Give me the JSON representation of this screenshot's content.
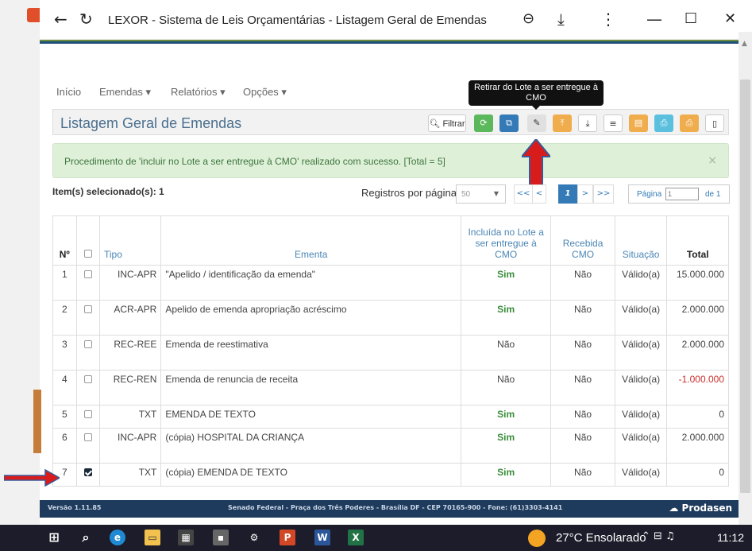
{
  "window": {
    "title": "LEXOR - Sistema de Leis Orçamentárias - Listagem Geral de Emendas"
  },
  "nav": {
    "items": [
      "Início",
      "Emendas ▾",
      "Relatórios ▾",
      "Opções ▾"
    ]
  },
  "panel": {
    "title": "Listagem Geral de Emendas",
    "filter_label": "Filtrar"
  },
  "toolbar_buttons": [
    {
      "icon": "refresh-icon",
      "color": "#5cb85c"
    },
    {
      "icon": "copy-icon",
      "color": "#337ab7"
    },
    {
      "icon": "edit-icon",
      "color": "#e0e0e0"
    },
    {
      "icon": "upload-icon",
      "color": "#f0ad4e"
    },
    {
      "icon": "download-icon",
      "color": "#ffffff"
    },
    {
      "icon": "list-icon",
      "color": "#ffffff"
    },
    {
      "icon": "document-icon",
      "color": "#f0ad4e"
    },
    {
      "icon": "print-icon",
      "color": "#5bc0de"
    },
    {
      "icon": "print-icon",
      "color": "#f0ad4e"
    },
    {
      "icon": "file-icon",
      "color": "#ffffff"
    }
  ],
  "tooltip": {
    "line1": "Retirar do Lote a ser entregue à",
    "line2": "CMO"
  },
  "alert": {
    "message": "Procedimento de 'incluir no Lote a ser entregue à CMO' realizado com sucesso. [Total = 5]",
    "close": "×"
  },
  "selection": {
    "label": "Item(s) selecionado(s): 1"
  },
  "pagination": {
    "per_page_label": "Registros por página:",
    "per_page_value": "50",
    "first": "<<",
    "prev": "<",
    "current": "1",
    "next": ">",
    "last": ">>",
    "page_label": "Página",
    "page_value": "1",
    "of_label": "de 1"
  },
  "table": {
    "headers": {
      "num": "Nº",
      "tipo": "Tipo",
      "ementa": "Ementa",
      "lote": "Incluída no Lote a ser entregue à CMO",
      "recebida": "Recebida CMO",
      "situacao": "Situação",
      "total": "Total"
    },
    "rows": [
      {
        "num": "1",
        "checked": false,
        "tipo": "INC-APR",
        "ementa": "\"Apelido / identificação da emenda\"",
        "lote": "Sim",
        "recebida": "Não",
        "situacao": "Válido(a)",
        "total": "15.000.000",
        "negative": false
      },
      {
        "num": "2",
        "checked": false,
        "tipo": "ACR-APR",
        "ementa": "Apelido de emenda apropriação acréscimo",
        "lote": "Sim",
        "recebida": "Não",
        "situacao": "Válido(a)",
        "total": "2.000.000",
        "negative": false
      },
      {
        "num": "3",
        "checked": false,
        "tipo": "REC-REE",
        "ementa": "Emenda de reestimativa",
        "lote": "Não",
        "recebida": "Não",
        "situacao": "Válido(a)",
        "total": "2.000.000",
        "negative": false
      },
      {
        "num": "4",
        "checked": false,
        "tipo": "REC-REN",
        "ementa": "Emenda de renuncia de receita",
        "lote": "Não",
        "recebida": "Não",
        "situacao": "Válido(a)",
        "total": "-1.000.000",
        "negative": true
      },
      {
        "num": "5",
        "checked": false,
        "tipo": "TXT",
        "ementa": "EMENDA DE TEXTO",
        "lote": "Sim",
        "recebida": "Não",
        "situacao": "Válido(a)",
        "total": "0",
        "negative": false
      },
      {
        "num": "6",
        "checked": false,
        "tipo": "INC-APR",
        "ementa": "(cópia) HOSPITAL DA CRIANÇA",
        "lote": "Sim",
        "recebida": "Não",
        "situacao": "Válido(a)",
        "total": "2.000.000",
        "negative": false
      },
      {
        "num": "7",
        "checked": true,
        "tipo": "TXT",
        "ementa": "(cópia) EMENDA DE TEXTO",
        "lote": "Sim",
        "recebida": "Não",
        "situacao": "Válido(a)",
        "total": "0",
        "negative": false
      }
    ]
  },
  "footer": {
    "version": "Versão 1.11.85",
    "address": "Senado Federal - Praça dos Três Poderes - Brasília DF - CEP 70165-900 - Fone: (61)3303-4141",
    "brand": "Prodasen"
  },
  "taskbar": {
    "weather": "27°C Ensolarado",
    "time": "11:12"
  }
}
